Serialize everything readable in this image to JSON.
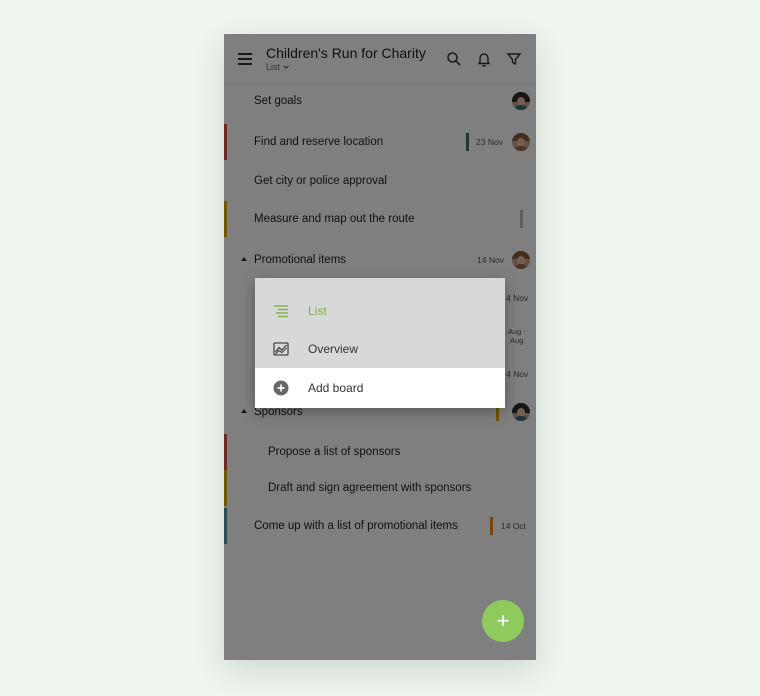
{
  "header": {
    "title": "Children's Run for Charity",
    "view_label": "List"
  },
  "tasks": [
    {
      "label": "Set goals",
      "date": "",
      "bar_color": "",
      "mark_color": "",
      "avatar": true
    },
    {
      "label": "Find and reserve location",
      "date": "23 Nov",
      "bar_color": "#d9534f",
      "mark_color": "#3a7a55",
      "avatar": true
    },
    {
      "label": "Get city or police approval",
      "date": "",
      "bar_color": "",
      "mark_color": "",
      "avatar": false
    },
    {
      "label": "Measure and map out the route",
      "date": "",
      "bar_color": "#e0b100",
      "mark_color": "#bdbdbd",
      "avatar": false
    },
    {
      "label": "Promotional items",
      "date": "14 Nov",
      "bar_color": "",
      "mark_color": "",
      "avatar": true,
      "group": true
    },
    {
      "label": "",
      "date": "4 Nov",
      "partial": true
    },
    {
      "label": "",
      "date": "Aug -",
      "date2": "Aug",
      "partial": true
    },
    {
      "label": "",
      "date": "4 Nov",
      "partial": true
    },
    {
      "label": "Sponsors",
      "date": "",
      "bar_color": "",
      "mark_color": "#e0b100",
      "avatar": true,
      "group": true
    },
    {
      "label": "Propose a list of sponsors",
      "date": "",
      "bar_color": "#d9534f",
      "indent": true
    },
    {
      "label": "Draft and sign agreement with sponsors",
      "date": "",
      "bar_color": "#e0b100",
      "indent": true
    },
    {
      "label": "Come up with a list of promotional items",
      "date": "14 Oct",
      "bar_color": "#5a9aa8",
      "mark_color": "#e8892b"
    }
  ],
  "view_menu": {
    "items": [
      {
        "label": "List",
        "icon": "list-icon",
        "active": true
      },
      {
        "label": "Overview",
        "icon": "overview-chart-icon",
        "active": false
      },
      {
        "label": "Add board",
        "icon": "add-circle-icon",
        "active": false
      }
    ]
  },
  "fab": {
    "label": "+"
  },
  "colors": {
    "accent": "#8fca5e",
    "active_text": "#7cb342",
    "red": "#d9534f",
    "yellow": "#e0b100",
    "teal": "#5a9aa8",
    "orange": "#e8892b",
    "green_mark": "#3a7a55"
  }
}
